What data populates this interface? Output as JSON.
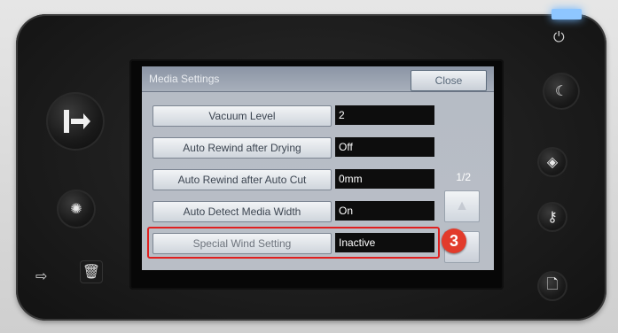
{
  "screen": {
    "title": "Media Settings",
    "close_label": "Close",
    "page_indicator": "1/2",
    "rows": [
      {
        "label": "Vacuum Level",
        "value": "2"
      },
      {
        "label": "Auto Rewind after Drying",
        "value": "Off"
      },
      {
        "label": "Auto Rewind after Auto Cut",
        "value": "0mm"
      },
      {
        "label": "Auto Detect Media Width",
        "value": "On"
      },
      {
        "label": "Special Wind Setting",
        "value": "Inactive"
      }
    ],
    "callout_number": "3"
  },
  "icons": {
    "power": "power-icon",
    "moon": "moon-icon",
    "exit": "exit-arrow-icon",
    "settings": "settings-icon",
    "diamond": "diamond-icon",
    "key": "key-icon",
    "document": "document-icon",
    "up": "up-arrow-icon"
  },
  "colors": {
    "highlight": "#e02020",
    "callout": "#e23b2b",
    "led": "#8ec6ff"
  }
}
